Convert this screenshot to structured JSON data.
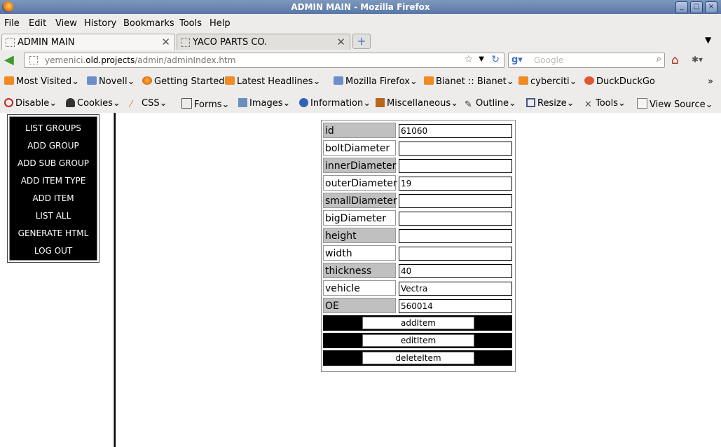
{
  "window": {
    "title": "ADMIN MAIN - Mozilla Firefox"
  },
  "menu": [
    "File",
    "Edit",
    "View",
    "History",
    "Bookmarks",
    "Tools",
    "Help"
  ],
  "tabs": [
    {
      "label": "ADMIN MAIN",
      "active": true
    },
    {
      "label": "YACO PARTS CO.",
      "active": false
    }
  ],
  "nav": {
    "url_prefix": "yemenici.",
    "url_host": "old.projects",
    "url_path": "/admin/adminIndex.htm",
    "search_placeholder": "Google"
  },
  "bookmarks": [
    "Most Visited",
    "Novell",
    "Getting Started",
    "Latest Headlines",
    "Mozilla Firefox",
    "Bianet :: Bianet",
    "cyberciti",
    "DuckDuckGo"
  ],
  "devtools": [
    "Disable",
    "Cookies",
    "CSS",
    "Forms",
    "Images",
    "Information",
    "Miscellaneous",
    "Outline",
    "Resize",
    "Tools",
    "View Source"
  ],
  "admin_menu": [
    "LIST GROUPS",
    "ADD GROUP",
    "ADD SUB GROUP",
    "ADD ITEM TYPE",
    "ADD ITEM",
    "LIST ALL",
    "GENERATE HTML",
    "LOG OUT"
  ],
  "form": {
    "fields": [
      {
        "label": "id",
        "value": "61060"
      },
      {
        "label": "boltDiameter",
        "value": ""
      },
      {
        "label": "innerDiameter",
        "value": ""
      },
      {
        "label": "outerDiameter",
        "value": "19"
      },
      {
        "label": "smallDiameter",
        "value": ""
      },
      {
        "label": "bigDiameter",
        "value": ""
      },
      {
        "label": "height",
        "value": ""
      },
      {
        "label": "width",
        "value": ""
      },
      {
        "label": "thickness",
        "value": "40"
      },
      {
        "label": "vehicle",
        "value": "Vectra"
      },
      {
        "label": "OE",
        "value": "560014"
      }
    ],
    "buttons": [
      "addItem",
      "editItem",
      "deleteItem"
    ]
  },
  "colors": {
    "label_shaded": "#c0c0c0",
    "menu_bg": "#000000",
    "title_bar": "#6a86b2"
  }
}
